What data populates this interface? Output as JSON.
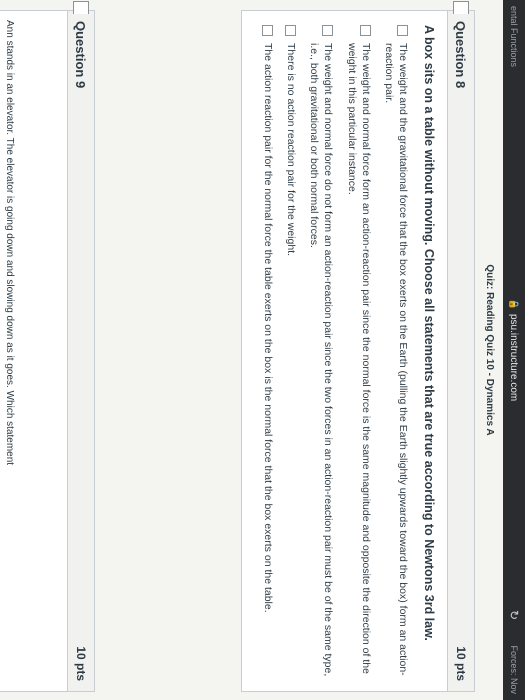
{
  "browser": {
    "url": "psu.instructure.com",
    "left_edge_text": "ental Functions",
    "right_edge_text": "Forces: Nov"
  },
  "quiz": {
    "title": "Quiz: Reading Quiz 10 - Dynamics A"
  },
  "question8": {
    "name": "Question 8",
    "points": "10 pts",
    "prompt": "A box sits on a table without moving. Choose all statements that are true according to Newtons 3rd law.",
    "options": [
      "The weight and the gravitational force that the box exerts on the Earth (pulling the Earth slightly upwards toward the box) form an action-reaction pair.",
      "The weight and normal force form an action-reaction pair since the normal force is the same magnitude and opposite the direction of the weight in this particular instance.",
      "The weight and normal force do not form an action-reaction pair since the two forces in an action-reaction pair must be of the same type, i.e., both gravitational or both normal forces.",
      "There is no action reaction pair for the weight.",
      "The action reaction pair for the normal force the table exerts on the box is the normal force that the box exerts on the table."
    ]
  },
  "question9": {
    "name": "Question 9",
    "points": "10 pts",
    "prompt_partial": "Ann stands in an elevator. The elevator is going down and slowing down as it goes. Which statement"
  }
}
